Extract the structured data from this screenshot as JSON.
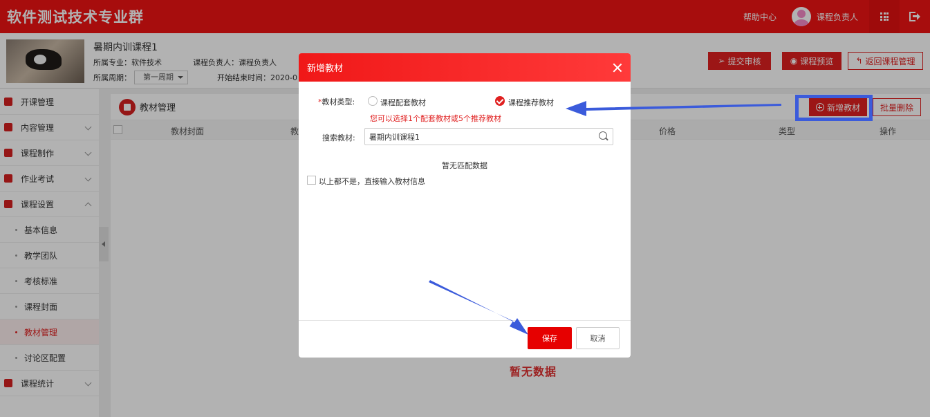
{
  "header": {
    "brand": "软件测试技术专业群",
    "help": "帮助中心",
    "user": "课程负责人"
  },
  "course": {
    "title": "暑期内训课程1",
    "major": "所属专业：软件技术",
    "owner": "课程负责人：课程负责人",
    "period_label": "所属周期：",
    "period_value": "第一周期",
    "time": "开始结束时间：2020-0",
    "actions": {
      "submit": "提交审核",
      "preview": "课程预览",
      "back": "返回课程管理"
    }
  },
  "sidebar": {
    "items": [
      {
        "label": "开课管理"
      },
      {
        "label": "内容管理"
      },
      {
        "label": "课程制作"
      },
      {
        "label": "作业考试"
      },
      {
        "label": "课程设置"
      }
    ],
    "sub_items": [
      {
        "label": "基本信息"
      },
      {
        "label": "教学团队"
      },
      {
        "label": "考核标准"
      },
      {
        "label": "课程封面"
      },
      {
        "label": "教材管理"
      },
      {
        "label": "讨论区配置"
      }
    ],
    "last_item": {
      "label": "课程统计"
    }
  },
  "content": {
    "title": "教材管理",
    "add_button": "新增教材",
    "batch_delete": "批量删除",
    "columns": [
      "教材封面",
      "教",
      "价格",
      "类型",
      "操作"
    ],
    "empty": "暂无数据"
  },
  "modal": {
    "title": "新增教材",
    "type_label": "教材类型:",
    "options": [
      "课程配套教材",
      "课程推荐教材"
    ],
    "hint": "您可以选择1个配套教材或5个推荐教材",
    "search_label": "搜索教材:",
    "search_value": "暑期内训课程1",
    "empty_text": "暂无匹配数据",
    "manual_label": "以上都不是，直接输入教材信息",
    "save": "保存",
    "cancel": "取消"
  },
  "colors": {
    "brand": "#f01414",
    "accent": "#e02020",
    "annotation": "#3b5bdb"
  }
}
